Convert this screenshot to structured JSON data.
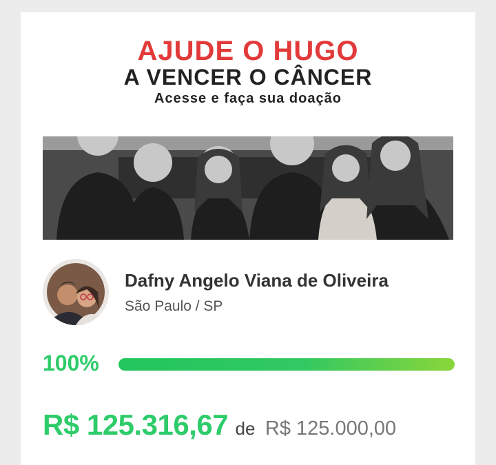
{
  "campaign": {
    "banner": {
      "headline": "AJUDE O HUGO",
      "subheadline": "A VENCER O CÂNCER",
      "tagline": "Acesse e faça sua doação"
    },
    "creator": {
      "name": "Dafny Angelo Viana de Oliveira",
      "location": "São Paulo / SP"
    },
    "progress": {
      "percent_label": "100%",
      "fraction": 1.0
    },
    "amounts": {
      "raised": "R$ 125.316,67",
      "of_word": "de",
      "goal": "R$ 125.000,00"
    }
  },
  "colors": {
    "accent_green": "#2ecc6a",
    "headline_red": "#e23a3a",
    "card_bg": "#ffffff",
    "page_bg": "#ececec"
  }
}
